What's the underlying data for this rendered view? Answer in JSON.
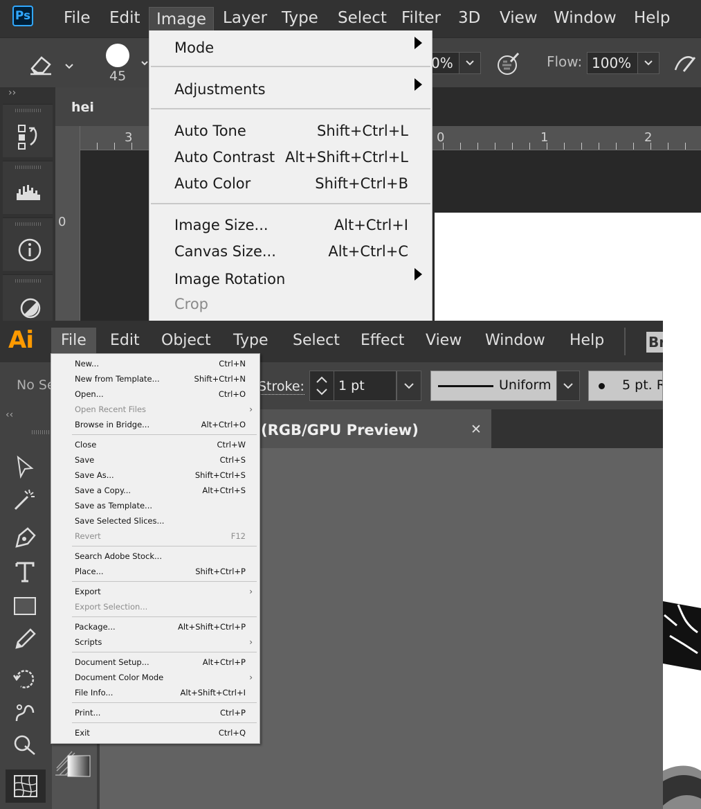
{
  "photoshop": {
    "logo": "Ps",
    "menu": [
      "File",
      "Edit",
      "Image",
      "Layer",
      "Type",
      "Select",
      "Filter",
      "3D",
      "View",
      "Window",
      "Help"
    ],
    "options": {
      "brush_size": "45",
      "opacity_fragment": "0%",
      "flow_label": "Flow:",
      "flow_value": "100%"
    },
    "doc_tab": "hei hei.psd",
    "ruler_numbers": {
      "top_left": "3",
      "top_0": "0",
      "top_1": "1",
      "top_2": "2",
      "left_0": "0"
    },
    "image_menu": {
      "mode": "Mode",
      "adjustments": "Adjustments",
      "auto_tone": "Auto Tone",
      "auto_tone_sc": "Shift+Ctrl+L",
      "auto_contrast": "Auto Contrast",
      "auto_contrast_sc": "Alt+Shift+Ctrl+L",
      "auto_color": "Auto Color",
      "auto_color_sc": "Shift+Ctrl+B",
      "image_size": "Image Size...",
      "image_size_sc": "Alt+Ctrl+I",
      "canvas_size": "Canvas Size...",
      "canvas_size_sc": "Alt+Ctrl+C",
      "image_rotation": "Image Rotation",
      "crop": "Crop"
    }
  },
  "illustrator": {
    "logo": "Ai",
    "menu": [
      "File",
      "Edit",
      "Object",
      "Type",
      "Select",
      "Effect",
      "View",
      "Window",
      "Help"
    ],
    "bridge_fragment": "Br",
    "options": {
      "selection_fragment": "No Se",
      "stroke_label": "Stroke:",
      "stroke_value": "1 pt",
      "profile": "Uniform",
      "brush": "5 pt. R"
    },
    "doc_tab": "(RGB/GPU Preview)",
    "close_symbol": "✕",
    "file_menu": [
      {
        "label": "New...",
        "sc": "Ctrl+N",
        "disabled": false,
        "sub": false
      },
      {
        "label": "New from Template...",
        "sc": "Shift+Ctrl+N",
        "disabled": false,
        "sub": false
      },
      {
        "label": "Open...",
        "sc": "Ctrl+O",
        "disabled": false,
        "sub": false
      },
      {
        "label": "Open Recent Files",
        "sc": "",
        "disabled": true,
        "sub": true
      },
      {
        "label": "Browse in Bridge...",
        "sc": "Alt+Ctrl+O",
        "disabled": false,
        "sub": false
      },
      {
        "label": "Close",
        "sc": "Ctrl+W",
        "disabled": false,
        "sub": false
      },
      {
        "label": "Save",
        "sc": "Ctrl+S",
        "disabled": false,
        "sub": false
      },
      {
        "label": "Save As...",
        "sc": "Shift+Ctrl+S",
        "disabled": false,
        "sub": false
      },
      {
        "label": "Save a Copy...",
        "sc": "Alt+Ctrl+S",
        "disabled": false,
        "sub": false
      },
      {
        "label": "Save as Template...",
        "sc": "",
        "disabled": false,
        "sub": false
      },
      {
        "label": "Save Selected Slices...",
        "sc": "",
        "disabled": false,
        "sub": false
      },
      {
        "label": "Revert",
        "sc": "F12",
        "disabled": true,
        "sub": false
      },
      {
        "label": "Search Adobe Stock...",
        "sc": "",
        "disabled": false,
        "sub": false
      },
      {
        "label": "Place...",
        "sc": "Shift+Ctrl+P",
        "disabled": false,
        "sub": false
      },
      {
        "label": "Export",
        "sc": "",
        "disabled": false,
        "sub": true
      },
      {
        "label": "Export Selection...",
        "sc": "",
        "disabled": true,
        "sub": false
      },
      {
        "label": "Package...",
        "sc": "Alt+Shift+Ctrl+P",
        "disabled": false,
        "sub": false
      },
      {
        "label": "Scripts",
        "sc": "",
        "disabled": false,
        "sub": true
      },
      {
        "label": "Document Setup...",
        "sc": "Alt+Ctrl+P",
        "disabled": false,
        "sub": false
      },
      {
        "label": "Document Color Mode",
        "sc": "",
        "disabled": false,
        "sub": true
      },
      {
        "label": "File Info...",
        "sc": "Alt+Shift+Ctrl+I",
        "disabled": false,
        "sub": false
      },
      {
        "label": "Print...",
        "sc": "Ctrl+P",
        "disabled": false,
        "sub": false
      },
      {
        "label": "Exit",
        "sc": "Ctrl+Q",
        "disabled": false,
        "sub": false
      }
    ]
  }
}
